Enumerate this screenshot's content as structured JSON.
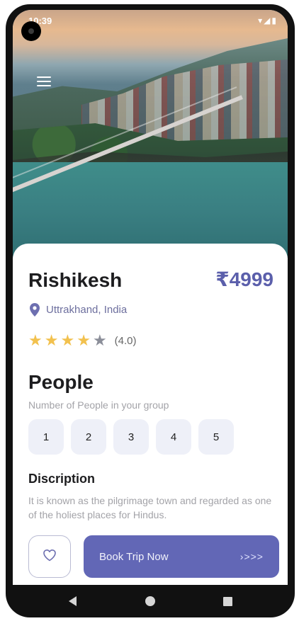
{
  "status_bar": {
    "time": "10:39",
    "icons": [
      "sd-card-icon",
      "sync-icon",
      "wifi-icon",
      "signal-icon",
      "battery-icon"
    ]
  },
  "hero": {
    "image": "rishikesh-bridge-river-photo",
    "menu_icon": "hamburger-menu-icon"
  },
  "destination": {
    "name": "Rishikesh",
    "price": "₹4999",
    "location": "Uttrakhand, India",
    "rating": 4.0,
    "rating_text": "(4.0)",
    "stars_filled": 4,
    "stars_total": 5
  },
  "people": {
    "title": "People",
    "subtitle": "Number of People in your group",
    "options": [
      "1",
      "2",
      "3",
      "4",
      "5"
    ]
  },
  "description": {
    "title": "Discription",
    "text": "It is known as the pilgrimage town and regarded as one of the holiest places for Hindus."
  },
  "actions": {
    "favorite_icon": "heart-icon",
    "book_label": "Book Trip Now",
    "book_arrows": "›>>>"
  },
  "colors": {
    "accent": "#6267b6",
    "price": "#5b5fab",
    "star": "#f2c14e",
    "chip_bg": "#eef0f8"
  }
}
